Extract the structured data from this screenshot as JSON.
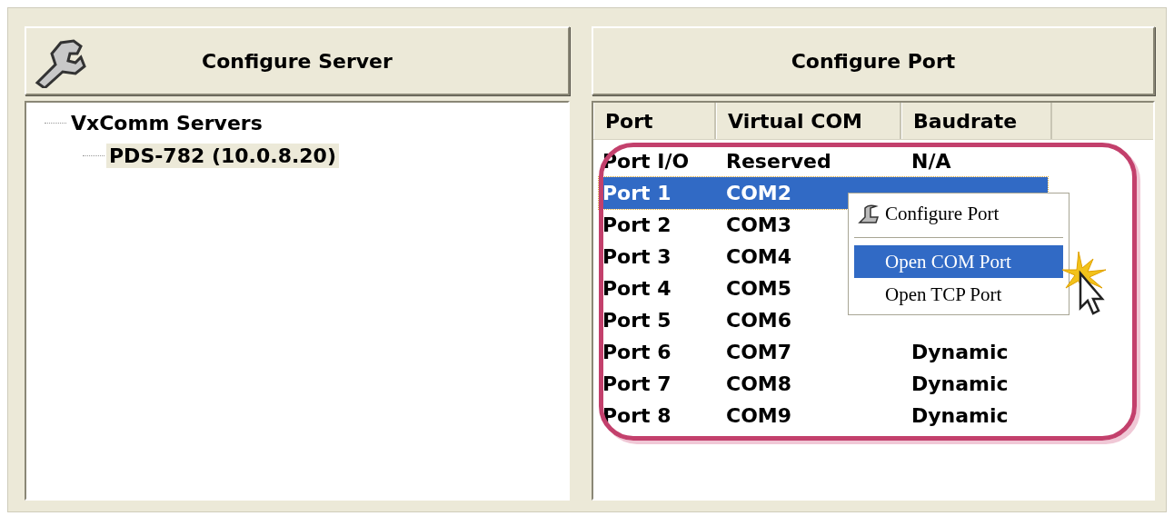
{
  "server_panel": {
    "title": "Configure Server",
    "tree": [
      {
        "label": "VxComm Servers",
        "selected": false,
        "children": [
          {
            "label": "PDS-782 (10.0.8.20)",
            "selected": true
          }
        ]
      }
    ]
  },
  "port_panel": {
    "title": "Configure Port",
    "columns": [
      "Port",
      "Virtual COM",
      "Baudrate"
    ],
    "rows": [
      {
        "port": "Port I/O",
        "com": "Reserved",
        "baudrate": "N/A",
        "selected": false
      },
      {
        "port": "Port 1",
        "com": "COM2",
        "selected": true
      },
      {
        "port": "Port 2",
        "com": "COM3",
        "selected": false
      },
      {
        "port": "Port 3",
        "com": "COM4",
        "selected": false
      },
      {
        "port": "Port 4",
        "com": "COM5",
        "selected": false
      },
      {
        "port": "Port 5",
        "com": "COM6",
        "selected": false
      },
      {
        "port": "Port 6",
        "com": "COM7",
        "baudrate": "Dynamic",
        "selected": false
      },
      {
        "port": "Port 7",
        "com": "COM8",
        "baudrate": "Dynamic",
        "selected": false
      },
      {
        "port": "Port 8",
        "com": "COM9",
        "baudrate": "Dynamic",
        "selected": false
      }
    ]
  },
  "context_menu": {
    "items": [
      {
        "kind": "item",
        "label": "Configure Port",
        "icon": true,
        "selected": false
      },
      {
        "kind": "separator"
      },
      {
        "kind": "item",
        "label": "Open COM Port",
        "icon": false,
        "selected": true
      },
      {
        "kind": "item",
        "label": "Open TCP Port",
        "icon": false,
        "selected": false
      }
    ]
  }
}
